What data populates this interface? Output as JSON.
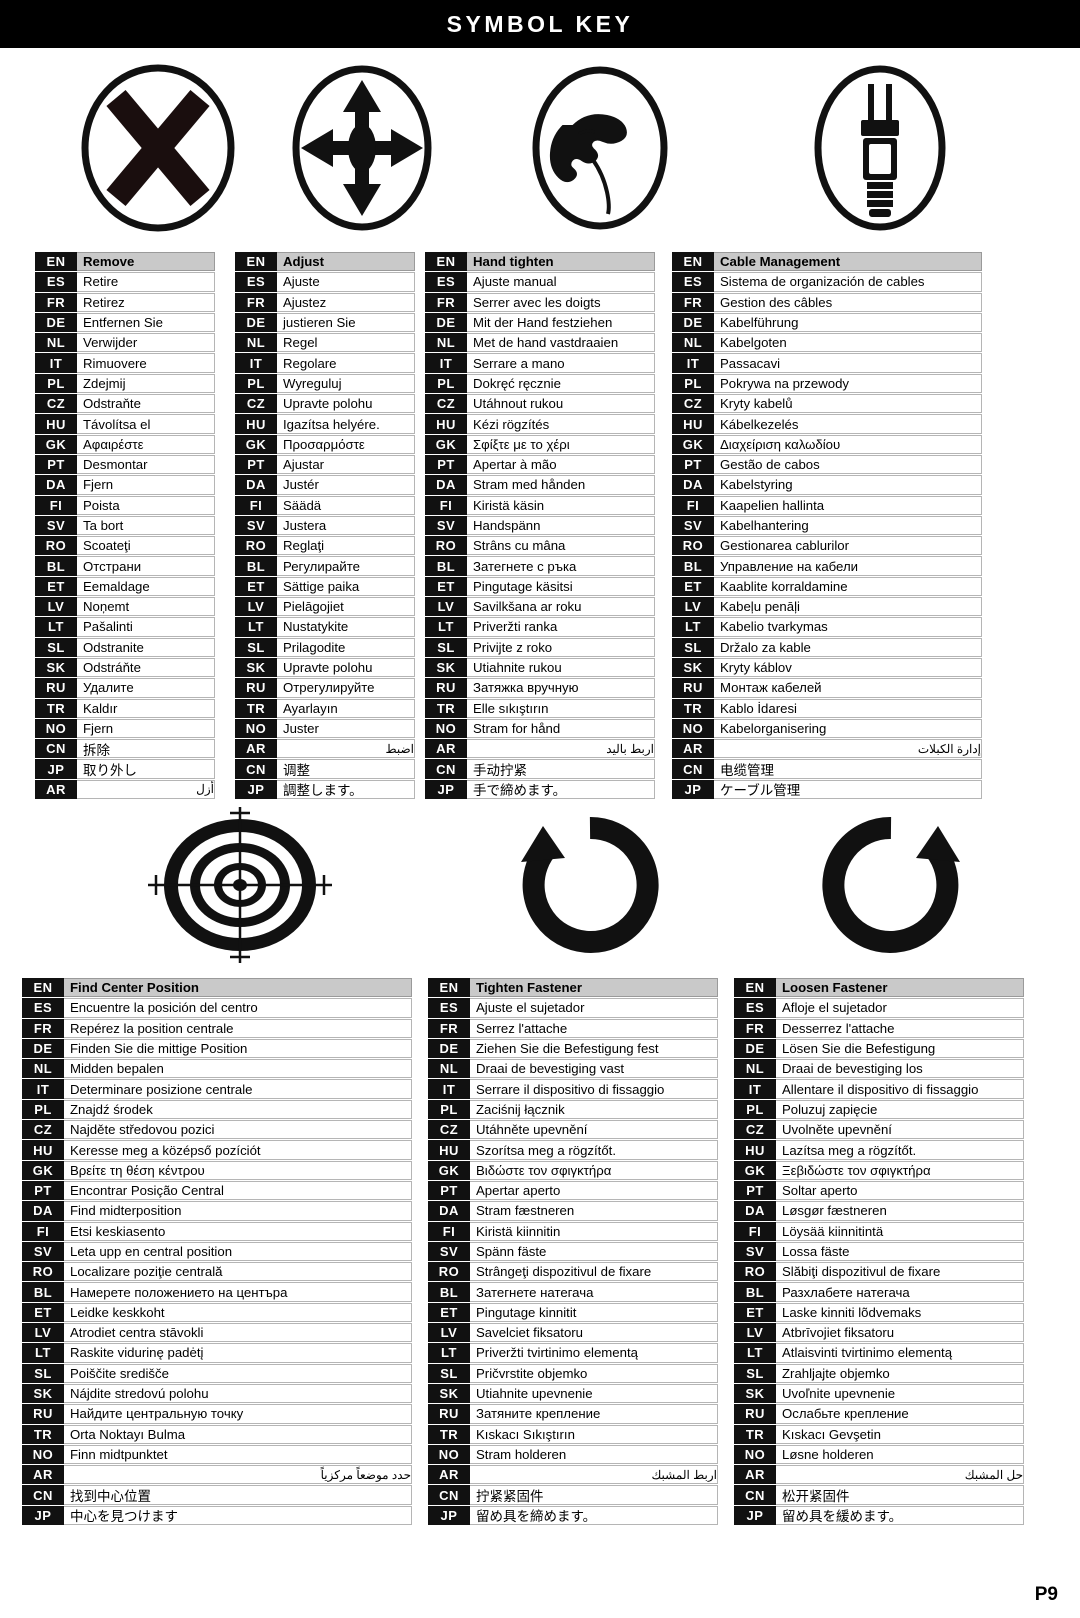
{
  "header": {
    "title": "SYMBOL KEY"
  },
  "page_number": "P9",
  "language_codes_top": [
    "EN",
    "ES",
    "FR",
    "DE",
    "NL",
    "IT",
    "PL",
    "CZ",
    "HU",
    "GK",
    "PT",
    "DA",
    "FI",
    "SV",
    "RO",
    "BL",
    "ET",
    "LV",
    "LT",
    "SL",
    "SK",
    "RU",
    "TR",
    "NO",
    "CN",
    "JP",
    "AR"
  ],
  "icons_top": [
    {
      "name": "no-x-circle-icon",
      "label": "do-not / remove cross in circle"
    },
    {
      "name": "four-arrows-circle-icon",
      "label": "adjust four-direction arrows in circle"
    },
    {
      "name": "hand-tighten-circle-icon",
      "label": "hand gripping in circle"
    },
    {
      "name": "power-plug-circle-icon",
      "label": "cable plug in circle"
    }
  ],
  "icons_bottom": [
    {
      "name": "crosshair-target-icon",
      "label": "find center position target"
    },
    {
      "name": "clockwise-arrow-icon",
      "label": "tighten fastener rotation arrow"
    },
    {
      "name": "counterclockwise-arrow-icon",
      "label": "loosen fastener rotation arrow"
    }
  ],
  "sections": [
    {
      "id": "top",
      "columns": [
        {
          "id": "remove",
          "icon": "no-x-circle-icon",
          "order": [
            "EN",
            "ES",
            "FR",
            "DE",
            "NL",
            "IT",
            "PL",
            "CZ",
            "HU",
            "GK",
            "PT",
            "DA",
            "FI",
            "SV",
            "RO",
            "BL",
            "ET",
            "LV",
            "LT",
            "SL",
            "SK",
            "RU",
            "TR",
            "NO",
            "CN",
            "JP",
            "AR"
          ],
          "entries": {
            "EN": "Remove",
            "ES": "Retire",
            "FR": "Retirez",
            "DE": "Entfernen Sie",
            "NL": "Verwijder",
            "IT": "Rimuovere",
            "PL": "Zdejmij",
            "CZ": "Odstraňte",
            "HU": "Távolítsa el",
            "GK": "Αφαιρέστε",
            "PT": "Desmontar",
            "DA": "Fjern",
            "FI": "Poista",
            "SV": "Ta bort",
            "RO": "Scoateţi",
            "BL": "Отстрани",
            "ET": "Eemaldage",
            "LV": "Noņemt",
            "LT": "Pašalinti",
            "SL": "Odstranite",
            "SK": "Odstráňte",
            "RU": "Удалите",
            "TR": "Kaldır",
            "NO": "Fjern",
            "CN": "拆除",
            "JP": "取り外し",
            "AR": "أزل"
          }
        },
        {
          "id": "adjust",
          "icon": "four-arrows-circle-icon",
          "order": [
            "EN",
            "ES",
            "FR",
            "DE",
            "NL",
            "IT",
            "PL",
            "CZ",
            "HU",
            "GK",
            "PT",
            "DA",
            "FI",
            "SV",
            "RO",
            "BL",
            "ET",
            "LV",
            "LT",
            "SL",
            "SK",
            "RU",
            "TR",
            "NO",
            "AR",
            "CN",
            "JP"
          ],
          "entries": {
            "EN": "Adjust",
            "ES": "Ajuste",
            "FR": "Ajustez",
            "DE": "justieren Sie",
            "NL": "Regel",
            "IT": "Regolare",
            "PL": "Wyreguluj",
            "CZ": "Upravte polohu",
            "HU": "Igazítsa helyére.",
            "GK": "Προσαρμόστε",
            "PT": "Ajustar",
            "DA": "Justér",
            "FI": "Säädä",
            "SV": "Justera",
            "RO": "Reglaţi",
            "BL": "Регулирайте",
            "ET": "Sättige paika",
            "LV": "Pielāgojiet",
            "LT": "Nustatykite",
            "SL": "Prilagodite",
            "SK": "Upravte polohu",
            "RU": "Отрегулируйте",
            "TR": "Ayarlayın",
            "NO": "Juster",
            "AR": "اضبط",
            "CN": "调整",
            "JP": "調整します。"
          }
        },
        {
          "id": "hand-tighten",
          "icon": "hand-tighten-circle-icon",
          "order": [
            "EN",
            "ES",
            "FR",
            "DE",
            "NL",
            "IT",
            "PL",
            "CZ",
            "HU",
            "GK",
            "PT",
            "DA",
            "FI",
            "SV",
            "RO",
            "BL",
            "ET",
            "LV",
            "LT",
            "SL",
            "SK",
            "RU",
            "TR",
            "NO",
            "AR",
            "CN",
            "JP"
          ],
          "entries": {
            "EN": "Hand tighten",
            "ES": "Ajuste manual",
            "FR": "Serrer avec les doigts",
            "DE": "Mit der Hand festziehen",
            "NL": "Met de hand vastdraaien",
            "IT": "Serrare a mano",
            "PL": "Dokręć ręcznie",
            "CZ": "Utáhnout rukou",
            "HU": "Kézi rögzítés",
            "GK": "Σφίξτε με το χέρι",
            "PT": "Apertar à mão",
            "DA": "Stram med hånden",
            "FI": "Kiristä käsin",
            "SV": "Handspänn",
            "RO": "Strâns cu mâna",
            "BL": "Затегнете с ръка",
            "ET": "Pingutage käsitsi",
            "LV": "Savilkšana ar roku",
            "LT": "Priveržti ranka",
            "SL": "Privijte z roko",
            "SK": "Utiahnite rukou",
            "RU": "Затяжка вручную",
            "TR": "Elle sıkıştırın",
            "NO": "Stram for hånd",
            "AR": "اربط باليد",
            "CN": "手动拧紧",
            "JP": "手で締めます。"
          }
        },
        {
          "id": "cable-management",
          "icon": "power-plug-circle-icon",
          "order": [
            "EN",
            "ES",
            "FR",
            "DE",
            "NL",
            "IT",
            "PL",
            "CZ",
            "HU",
            "GK",
            "PT",
            "DA",
            "FI",
            "SV",
            "RO",
            "BL",
            "ET",
            "LV",
            "LT",
            "SL",
            "SK",
            "RU",
            "TR",
            "NO",
            "AR",
            "CN",
            "JP"
          ],
          "entries": {
            "EN": "Cable Management",
            "ES": "Sistema de organización de cables",
            "FR": "Gestion des câbles",
            "DE": "Kabelführung",
            "NL": "Kabelgoten",
            "IT": "Passacavi",
            "PL": "Pokrywa na przewody",
            "CZ": "Kryty kabelů",
            "HU": "Kábelkezelés",
            "GK": "Διαχείριση καλωδίου",
            "PT": "Gestão de cabos",
            "DA": "Kabelstyring",
            "FI": "Kaapelien hallinta",
            "SV": "Kabelhantering",
            "RO": "Gestionarea cablurilor",
            "BL": "Управление на кабели",
            "ET": "Kaablite korraldamine",
            "LV": "Kabeļu penāļi",
            "LT": "Kabelio tvarkymas",
            "SL": "Držalo za kable",
            "SK": "Kryty káblov",
            "RU": "Монтаж кабелей",
            "TR": "Kablo İdaresi",
            "NO": "Kabelorganisering",
            "AR": "إدارة الكبلات",
            "CN": "电缆管理",
            "JP": "ケーブル管理"
          }
        }
      ]
    },
    {
      "id": "bottom",
      "columns": [
        {
          "id": "find-center-position",
          "icon": "crosshair-target-icon",
          "order": [
            "EN",
            "ES",
            "FR",
            "DE",
            "NL",
            "IT",
            "PL",
            "CZ",
            "HU",
            "GK",
            "PT",
            "DA",
            "FI",
            "SV",
            "RO",
            "BL",
            "ET",
            "LV",
            "LT",
            "SL",
            "SK",
            "RU",
            "TR",
            "NO",
            "AR",
            "CN",
            "JP"
          ],
          "entries": {
            "EN": "Find Center Position",
            "ES": "Encuentre la posición del centro",
            "FR": "Repérez la position centrale",
            "DE": "Finden Sie die mittige Position",
            "NL": "Midden bepalen",
            "IT": "Determinare posizione centrale",
            "PL": "Znajdź środek",
            "CZ": "Najděte středovou pozici",
            "HU": "Keresse meg a középső pozíciót",
            "GK": "Βρείτε τη θέση κέντρου",
            "PT": "Encontrar Posição Central",
            "DA": "Find midterposition",
            "FI": "Etsi keskiasento",
            "SV": "Leta upp en central position",
            "RO": "Localizare poziţie centrală",
            "BL": "Намерете положението на центъра",
            "ET": "Leidke keskkoht",
            "LV": "Atrodiet centra stāvokli",
            "LT": "Raskite vidurinę padėtį",
            "SL": "Poiščite središče",
            "SK": "Nájdite stredovú polohu",
            "RU": "Найдите центральную точку",
            "TR": "Orta Noktayı Bulma",
            "NO": "Finn midtpunktet",
            "AR": "حدد موضعاً مركزياً",
            "CN": "找到中心位置",
            "JP": "中心を見つけます"
          }
        },
        {
          "id": "tighten-fastener",
          "icon": "clockwise-arrow-icon",
          "order": [
            "EN",
            "ES",
            "FR",
            "DE",
            "NL",
            "IT",
            "PL",
            "CZ",
            "HU",
            "GK",
            "PT",
            "DA",
            "FI",
            "SV",
            "RO",
            "BL",
            "ET",
            "LV",
            "LT",
            "SL",
            "SK",
            "RU",
            "TR",
            "NO",
            "AR",
            "CN",
            "JP"
          ],
          "entries": {
            "EN": "Tighten Fastener",
            "ES": "Ajuste el sujetador",
            "FR": "Serrez l'attache",
            "DE": "Ziehen Sie die Befestigung fest",
            "NL": "Draai de bevestiging vast",
            "IT": "Serrare il dispositivo di fissaggio",
            "PL": "Zaciśnij łącznik",
            "CZ": "Utáhněte upevnění",
            "HU": "Szorítsa meg a rögzítőt.",
            "GK": "Βιδώστε τον σφιγκτήρα",
            "PT": "Apertar aperto",
            "DA": "Stram fæstneren",
            "FI": "Kiristä kiinnitin",
            "SV": "Spänn fäste",
            "RO": "Strângeţi dispozitivul de fixare",
            "BL": "Затегнете натегача",
            "ET": "Pingutage kinnitit",
            "LV": "Savelciet fiksatoru",
            "LT": "Priveržti tvirtinimo elementą",
            "SL": "Pričvrstite objemko",
            "SK": "Utiahnite upevnenie",
            "RU": "Затяните крепление",
            "TR": "Kıskacı Sıkıştırın",
            "NO": "Stram holderen",
            "AR": "اربط المشبك",
            "CN": "拧紧紧固件",
            "JP": "留め具を締めます。"
          }
        },
        {
          "id": "loosen-fastener",
          "icon": "counterclockwise-arrow-icon",
          "order": [
            "EN",
            "ES",
            "FR",
            "DE",
            "NL",
            "IT",
            "PL",
            "CZ",
            "HU",
            "GK",
            "PT",
            "DA",
            "FI",
            "SV",
            "RO",
            "BL",
            "ET",
            "LV",
            "LT",
            "SL",
            "SK",
            "RU",
            "TR",
            "NO",
            "AR",
            "CN",
            "JP"
          ],
          "entries": {
            "EN": "Loosen Fastener",
            "ES": "Afloje el sujetador",
            "FR": "Desserrez l'attache",
            "DE": "Lösen Sie die Befestigung",
            "NL": "Draai de bevestiging los",
            "IT": "Allentare il dispositivo di fissaggio",
            "PL": "Poluzuj zapięcie",
            "CZ": "Uvolněte upevnění",
            "HU": "Lazítsa meg a rögzítőt.",
            "GK": "Ξεβιδώστε τον σφιγκτήρα",
            "PT": "Soltar aperto",
            "DA": "Løsgør fæstneren",
            "FI": "Löysää kiinnitintä",
            "SV": "Lossa fäste",
            "RO": "Slăbiţi dispozitivul de fixare",
            "BL": "Разхлабете натегача",
            "ET": "Laske kinniti lõdvemaks",
            "LV": "Atbrīvojiet fiksatoru",
            "LT": "Atlaisvinti tvirtinimo elementą",
            "SL": "Zrahljajte objemko",
            "SK": "Uvoľnite upevnenie",
            "RU": "Ослабьте крепление",
            "TR": "Kıskacı Gevşetin",
            "NO": "Løsne holderen",
            "AR": "حل المشبك",
            "CN": "松开紧固件",
            "JP": "留め具を緩めます。"
          }
        }
      ]
    }
  ]
}
